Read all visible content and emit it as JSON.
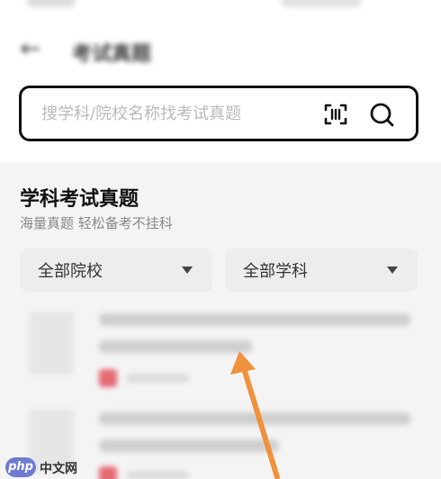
{
  "header": {
    "title": "考试真题",
    "back_icon": "arrow-left-icon"
  },
  "search": {
    "placeholder": "搜学科/院校名称找考试真题",
    "scan_icon": "scan-icon",
    "search_icon": "search-icon"
  },
  "section": {
    "title": "学科考试真题",
    "subtitle": "海量真题 轻松备考不挂科"
  },
  "filters": {
    "school": "全部院校",
    "subject": "全部学科"
  },
  "watermark": {
    "logo": "php",
    "text": "中文网"
  },
  "colors": {
    "accent_arrow": "#f0913d",
    "badge": "#e46a74",
    "section_bg": "#f4f4f4"
  }
}
